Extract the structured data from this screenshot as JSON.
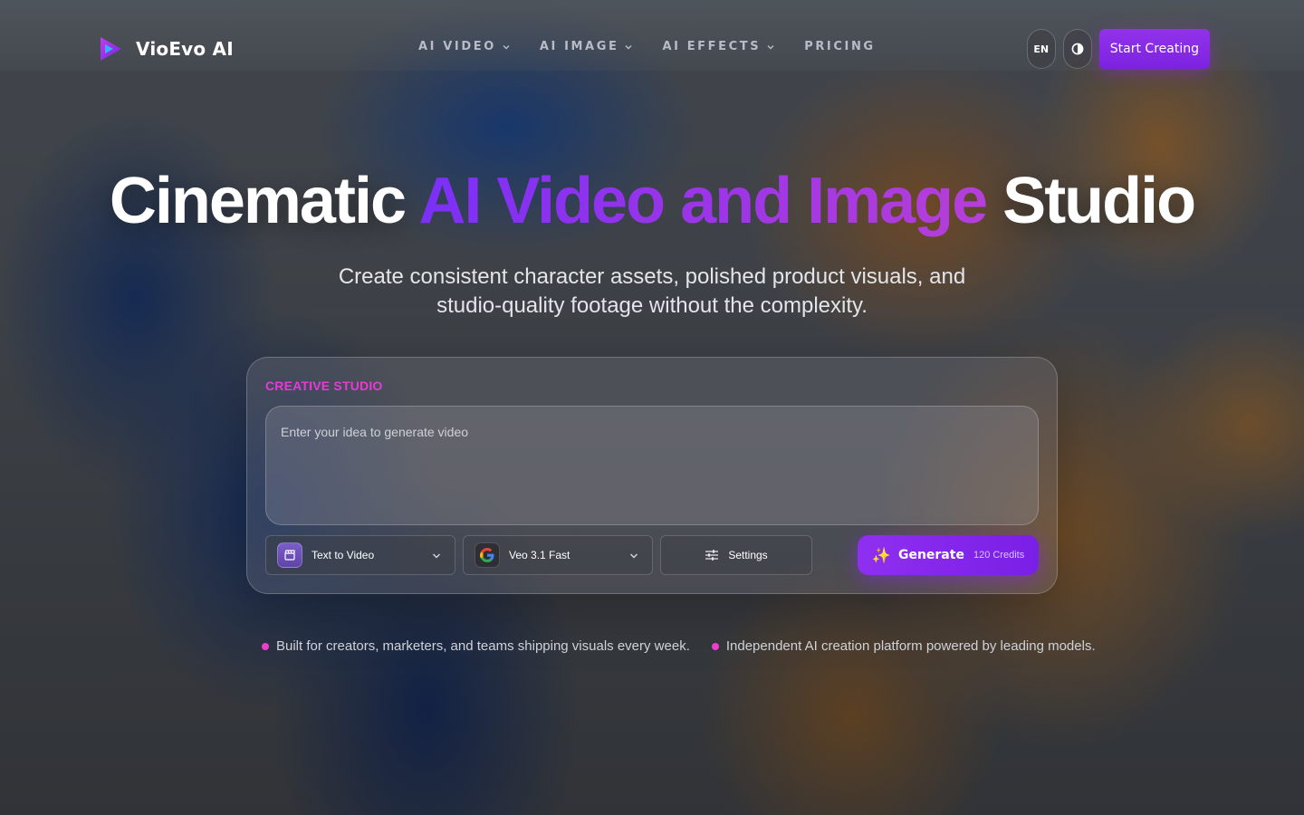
{
  "brand": {
    "name": "VioEvo AI",
    "logo_icon": "play-triangle-logo-icon"
  },
  "nav": {
    "items": [
      {
        "label": "AI VIDEO",
        "has_dropdown": true
      },
      {
        "label": "AI IMAGE",
        "has_dropdown": true
      },
      {
        "label": "AI EFFECTS",
        "has_dropdown": true
      },
      {
        "label": "PRICING",
        "has_dropdown": false
      }
    ],
    "language": "EN",
    "theme_toggle_icon": "half-circle-contrast-icon",
    "cta_label": "Start Creating"
  },
  "hero": {
    "title_start": "Cinematic ",
    "title_highlight": "AI Video and Image",
    "title_end": " Studio",
    "subtitle_line1": "Create consistent character assets, polished product visuals, and",
    "subtitle_line2": "studio-quality footage without the complexity."
  },
  "studio": {
    "label": "CREATIVE STUDIO",
    "prompt_placeholder": "Enter your idea to generate video",
    "prompt_value": "",
    "mode": {
      "label": "Text to Video",
      "icon": "clapperboard-icon"
    },
    "model": {
      "label": "Veo 3.1 Fast",
      "icon": "google-logo-icon"
    },
    "settings_label": "Settings",
    "generate_label": "Generate",
    "generate_credits": "120 Credits"
  },
  "bullets": [
    "Built for creators, marketers, and teams shipping visuals every week.",
    "Independent AI creation platform powered by leading models."
  ],
  "colors": {
    "accent": "#8a2be2",
    "studio_label": "#e83ad7",
    "bullet_dot": "#ec3fce",
    "title_gradient_start": "#7b2ff7",
    "title_gradient_end": "#b63fd8"
  }
}
